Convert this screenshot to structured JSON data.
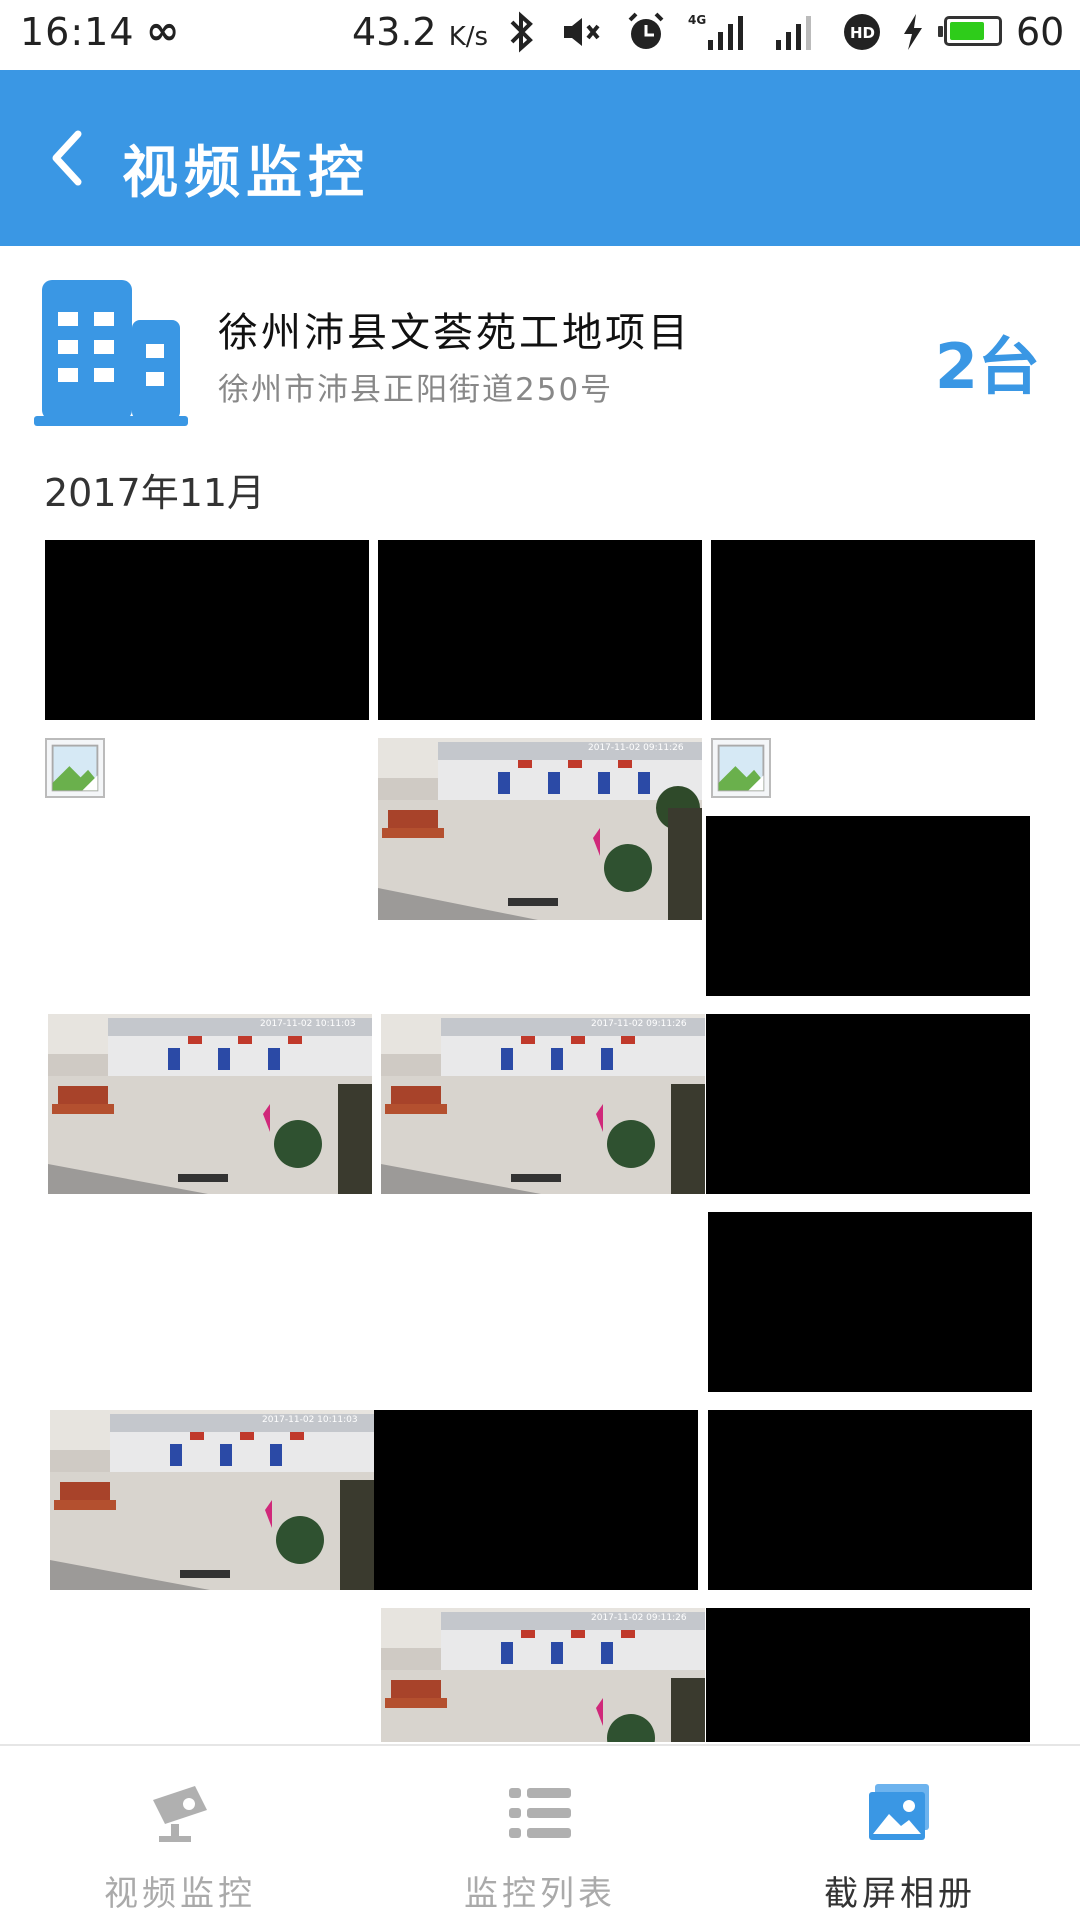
{
  "status_bar": {
    "time": "16:14",
    "infinity": "∞",
    "speed": "43.2",
    "speed_unit": "K/s",
    "battery_level": "60",
    "icons": [
      "bluetooth-icon",
      "mute-icon",
      "alarm-icon",
      "signal-4g-icon",
      "signal-icon",
      "hd-icon",
      "charging-icon",
      "battery-icon"
    ]
  },
  "header": {
    "title": "视频监控",
    "back_icon": "chevron-left-icon",
    "background_color": "#3a97e4"
  },
  "project": {
    "name": "徐州沛县文荟苑工地项目",
    "address": "徐州市沛县正阳街道250号",
    "device_count": "2台",
    "icon": "building-icon",
    "accent_color": "#3a97e4"
  },
  "gallery": {
    "month": "2017年11月",
    "timestamp_a": "2017-11-02 09:11:26",
    "timestamp_b": "2017-11-02 10:11:03",
    "items": [
      "black",
      "black",
      "black",
      "broken",
      "scene",
      "broken",
      "black",
      "scene",
      "scene",
      "black",
      "black",
      "scene",
      "black",
      "black",
      "scene",
      "black"
    ]
  },
  "tabbar": {
    "tabs": [
      {
        "label": "视频监控",
        "icon": "camera-icon",
        "active": false
      },
      {
        "label": "监控列表",
        "icon": "list-icon",
        "active": false
      },
      {
        "label": "截屏相册",
        "icon": "gallery-icon",
        "active": true
      }
    ]
  }
}
